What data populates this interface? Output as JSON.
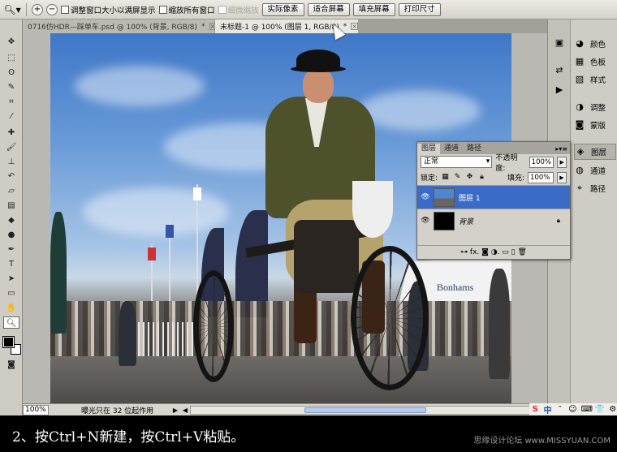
{
  "options_bar": {
    "tool_icon": "zoom-tool-icon",
    "zoom_in": "+",
    "zoom_out": "−",
    "resize_windows_label": "调整窗口大小以满屏显示",
    "zoom_all_windows_label": "缩放所有窗口",
    "scrubby_zoom_label": "细微缩放",
    "actual_pixels_label": "实际像素",
    "fit_screen_label": "适合屏幕",
    "fill_screen_label": "填充屏幕",
    "print_size_label": "打印尺寸"
  },
  "tabs": [
    {
      "label": "0716仿HDR—踩单车.psd @ 100% (背景, RGB/8)",
      "modified": "*",
      "close": "×"
    },
    {
      "label": "未标题-1 @ 100% (图层 1, RGB/8)",
      "modified": "*",
      "close": "×"
    }
  ],
  "photo": {
    "tent_text": "Bonhams"
  },
  "dock": {
    "items": [
      {
        "label": "颜色",
        "icon": "color-icon"
      },
      {
        "label": "色板",
        "icon": "swatches-icon"
      },
      {
        "label": "样式",
        "icon": "styles-icon"
      },
      {
        "label": "调整",
        "icon": "adjustments-icon"
      },
      {
        "label": "蒙版",
        "icon": "masks-icon"
      },
      {
        "label": "图层",
        "icon": "layers-icon"
      },
      {
        "label": "通道",
        "icon": "channels-icon"
      },
      {
        "label": "路径",
        "icon": "paths-icon"
      }
    ]
  },
  "layers_panel": {
    "tabs": [
      "图层",
      "通道",
      "路径"
    ],
    "menu": "▸▾≡",
    "blend_mode": "正常",
    "opacity_label": "不透明度:",
    "opacity_value": "100%",
    "lock_label": "锁定:",
    "fill_label": "填充:",
    "fill_value": "100%",
    "layers": [
      {
        "name": "图层 1",
        "selected": true
      },
      {
        "name": "背景",
        "selected": false,
        "italic": true
      }
    ],
    "bottom_icons": "⊶ fx. ◙ ◑. ▭ ▯ 🗑"
  },
  "status_bar": {
    "zoom": "100%",
    "text": "曝光只在 32 位起作用"
  },
  "ime": [
    "S",
    "中",
    "″",
    "☺",
    "⌨",
    "👕",
    "⚙"
  ],
  "caption": {
    "text": "2、按Ctrl+N新建，按Ctrl+V粘贴。",
    "watermark": "思缘设计论坛 www.MISSYUAN.COM"
  }
}
